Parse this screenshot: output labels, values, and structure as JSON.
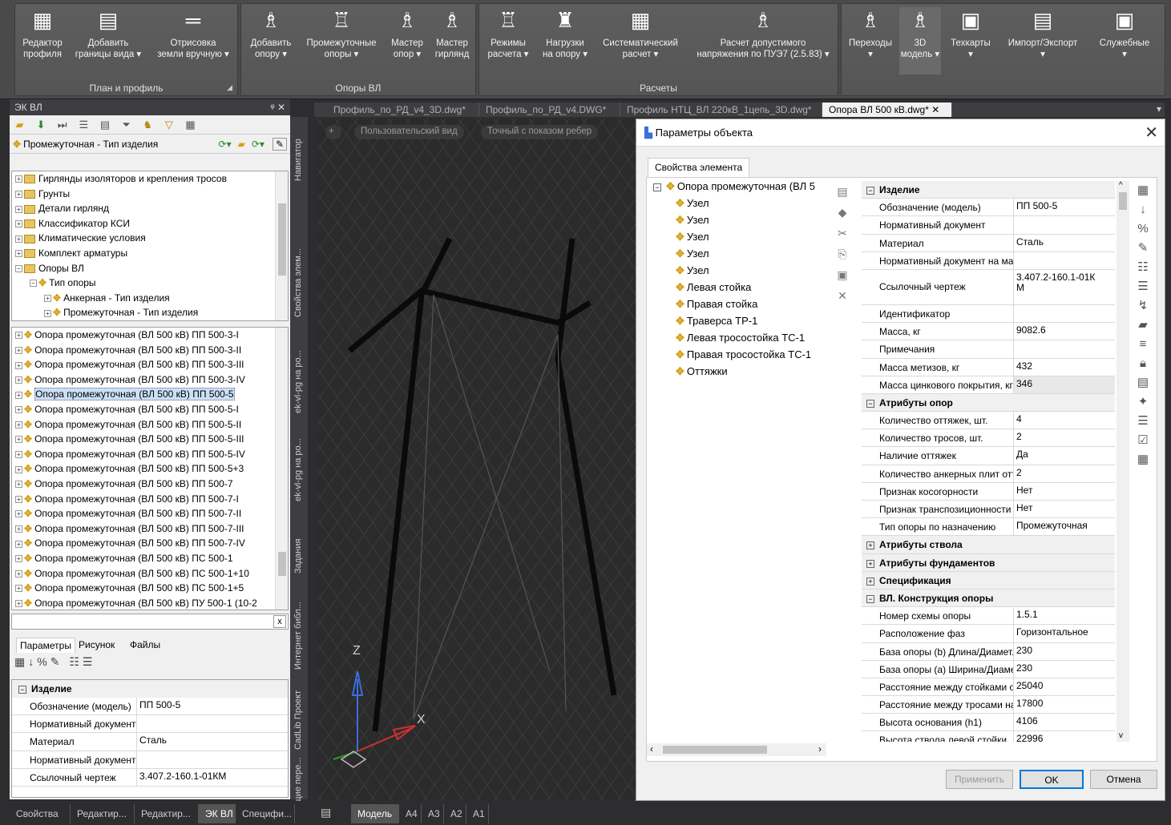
{
  "ribbon": {
    "groups": [
      {
        "label": "План и профиль",
        "buttons": [
          "Редактор\nпрофиля",
          "Добавить\nграницы вида ▾",
          "Отрисовка\nземли вручную ▾"
        ]
      },
      {
        "label": "Опоры ВЛ",
        "buttons": [
          "Добавить\nопору ▾",
          "Промежуточные\nопоры ▾",
          "Мастер\nопор ▾",
          "Мастер\nгирлянд"
        ]
      },
      {
        "label": "Расчеты",
        "buttons": [
          "Режимы\nрасчета ▾",
          "Нагрузки\nна опору ▾",
          "Систематический\nрасчет ▾",
          "Расчет допустимого\nнапряжения по ПУЭ7 (2.5.83) ▾"
        ]
      },
      {
        "label": "",
        "buttons": [
          "Переходы\n▾",
          "3D\nмодель ▾",
          "Техкарты\n▾",
          "Импорт/Экспорт\n▾",
          "Служебные\n▾"
        ]
      }
    ]
  },
  "left_panel": {
    "title": "ЭК ВЛ",
    "type_selector": "Промежуточная - Тип изделия",
    "upper_tree": [
      {
        "label": "Гирлянды изоляторов и крепления тросов",
        "level": 0,
        "expander": "+"
      },
      {
        "label": "Грунты",
        "level": 0,
        "expander": "+"
      },
      {
        "label": "Детали гирлянд",
        "level": 0,
        "expander": "+"
      },
      {
        "label": "Классификатор КСИ",
        "level": 0,
        "expander": "+"
      },
      {
        "label": "Климатические условия",
        "level": 0,
        "expander": "+"
      },
      {
        "label": "Комплект арматуры",
        "level": 0,
        "expander": "+"
      },
      {
        "label": "Опоры ВЛ",
        "level": 0,
        "expander": "−"
      },
      {
        "label": "Тип опоры",
        "level": 1,
        "expander": "−"
      },
      {
        "label": "Анкерная - Тип изделия",
        "level": 2,
        "expander": "+"
      },
      {
        "label": "Промежуточная - Тип изделия",
        "level": 2,
        "expander": "+"
      }
    ],
    "lower_list": [
      "Опора промежуточная (ВЛ 500 кВ) ПП 500-3-I",
      "Опора промежуточная (ВЛ 500 кВ) ПП 500-3-II",
      "Опора промежуточная (ВЛ 500 кВ) ПП 500-3-III",
      "Опора промежуточная (ВЛ 500 кВ) ПП 500-3-IV",
      "Опора промежуточная (ВЛ 500 кВ) ПП 500-5",
      "Опора промежуточная (ВЛ 500 кВ) ПП 500-5-I",
      "Опора промежуточная (ВЛ 500 кВ) ПП 500-5-II",
      "Опора промежуточная (ВЛ 500 кВ) ПП 500-5-III",
      "Опора промежуточная (ВЛ 500 кВ) ПП 500-5-IV",
      "Опора промежуточная (ВЛ 500 кВ) ПП 500-5+3",
      "Опора промежуточная (ВЛ 500 кВ) ПП 500-7",
      "Опора промежуточная (ВЛ 500 кВ) ПП 500-7-I",
      "Опора промежуточная (ВЛ 500 кВ) ПП 500-7-II",
      "Опора промежуточная (ВЛ 500 кВ) ПП 500-7-III",
      "Опора промежуточная (ВЛ 500 кВ) ПП 500-7-IV",
      "Опора промежуточная (ВЛ 500 кВ) ПС 500-1",
      "Опора промежуточная (ВЛ 500 кВ) ПС 500-1+10",
      "Опора промежуточная (ВЛ 500 кВ) ПС 500-1+5",
      "Опора промежуточная (ВЛ 500 кВ) ПУ 500-1 (10-2"
    ],
    "selected_index": 4,
    "search_close": "x",
    "prop_tabs": [
      "Параметры",
      "Рисунок",
      "Файлы"
    ],
    "prop_header": "Изделие",
    "props": [
      {
        "k": "Обозначение (модель)",
        "v": "ПП 500-5"
      },
      {
        "k": "Нормативный документ",
        "v": ""
      },
      {
        "k": "Материал",
        "v": "Сталь"
      },
      {
        "k": "Нормативный документ ...",
        "v": ""
      },
      {
        "k": "Ссылочный чертеж",
        "v": "3.407.2-160.1-01КМ"
      }
    ]
  },
  "side_tabs": [
    "Навигатор",
    "Свойства элем...",
    "ek-vl-pg на ро...",
    "ek-vl-pg на ро...",
    "Задания",
    "Интернет библ...",
    "CadLib Проект",
    "Текущие пере..."
  ],
  "doc_tabs": [
    {
      "label": "Профиль_по_РД_v4_3D.dwg*",
      "active": false
    },
    {
      "label": "Профиль_по_РД_v4.DWG*",
      "active": false
    },
    {
      "label": "Профиль НТЦ_ВЛ 220кВ_1цепь_3D.dwg*",
      "active": false
    },
    {
      "label": "Опора ВЛ 500 кВ.dwg*",
      "active": true
    }
  ],
  "viewport": {
    "view_label": "Пользовательский вид",
    "style_label": "Точный с показом ребер",
    "axis_z": "Z",
    "axis_x": "X"
  },
  "dialog": {
    "title": "Параметры объекта",
    "tab": "Свойства элемента",
    "object_tree": {
      "root": "Опора промежуточная (ВЛ 5",
      "children": [
        "Узел",
        "Узел",
        "Узел",
        "Узел",
        "Узел",
        "Левая стойка",
        "Правая стойка",
        "Траверса ТР-1",
        "Левая тросостойка ТС-1",
        "Правая тросостойка ТС-1",
        "Оттяжки"
      ]
    },
    "properties": [
      {
        "cat": "Изделие",
        "state": "−"
      },
      {
        "k": "Обозначение (модель)",
        "v": "ПП 500-5"
      },
      {
        "k": "Нормативный документ",
        "v": ""
      },
      {
        "k": "Материал",
        "v": "Сталь"
      },
      {
        "k": "Нормативный документ на ма...",
        "v": ""
      },
      {
        "k": "Ссылочный чертеж",
        "v": "3.407.2-160.1-01К\nМ",
        "tall": true
      },
      {
        "k": "Идентификатор",
        "v": ""
      },
      {
        "k": "Масса, кг",
        "v": "9082.6"
      },
      {
        "k": "Примечания",
        "v": ""
      },
      {
        "k": "Масса метизов, кг",
        "v": "432"
      },
      {
        "k": "Масса цинкового покрытия, кг",
        "v": "346",
        "shaded": true
      },
      {
        "cat": "Атрибуты опор",
        "state": "−"
      },
      {
        "k": "Количество оттяжек, шт.",
        "v": "4"
      },
      {
        "k": "Количество тросов, шт.",
        "v": "2"
      },
      {
        "k": "Наличие оттяжек",
        "v": "Да"
      },
      {
        "k": "Количество анкерных плит отт...",
        "v": "2"
      },
      {
        "k": "Признак косогорности",
        "v": "Нет"
      },
      {
        "k": "Признак транспозиционности",
        "v": "Нет"
      },
      {
        "k": "Тип опоры по назначению",
        "v": "Промежуточная"
      },
      {
        "cat": "Атрибуты ствола",
        "state": "+"
      },
      {
        "cat": "Атрибуты фундаментов",
        "state": "+"
      },
      {
        "cat": "Спецификация",
        "state": "+"
      },
      {
        "cat": "ВЛ. Конструкция опоры",
        "state": "−"
      },
      {
        "k": "Номер схемы опоры",
        "v": "1.5.1"
      },
      {
        "k": "Расположение фаз",
        "v": "Горизонтальное"
      },
      {
        "k": "База опоры (b) Длина/Диамет...",
        "v": "230"
      },
      {
        "k": "База опоры (a) Ширина/Диаме...",
        "v": "230"
      },
      {
        "k": "Расстояние между стойками о...",
        "v": "25040"
      },
      {
        "k": "Расстояние между тросами на...",
        "v": "17800"
      },
      {
        "k": "Высота основания (h1)",
        "v": "4106"
      },
      {
        "k": "Высота ствола левой стойки, ...",
        "v": "22996"
      }
    ],
    "buttons": {
      "apply": "Применить",
      "ok": "OK",
      "cancel": "Отмена"
    }
  },
  "bottom_tabs": {
    "left": [
      "Свойства",
      "Редактир...",
      "Редактир...",
      "ЭК ВЛ",
      "Специфи..."
    ],
    "left_active": 3,
    "layout": [
      "Модель",
      "A4",
      "A3",
      "A2",
      "A1"
    ],
    "layout_active": 0
  }
}
